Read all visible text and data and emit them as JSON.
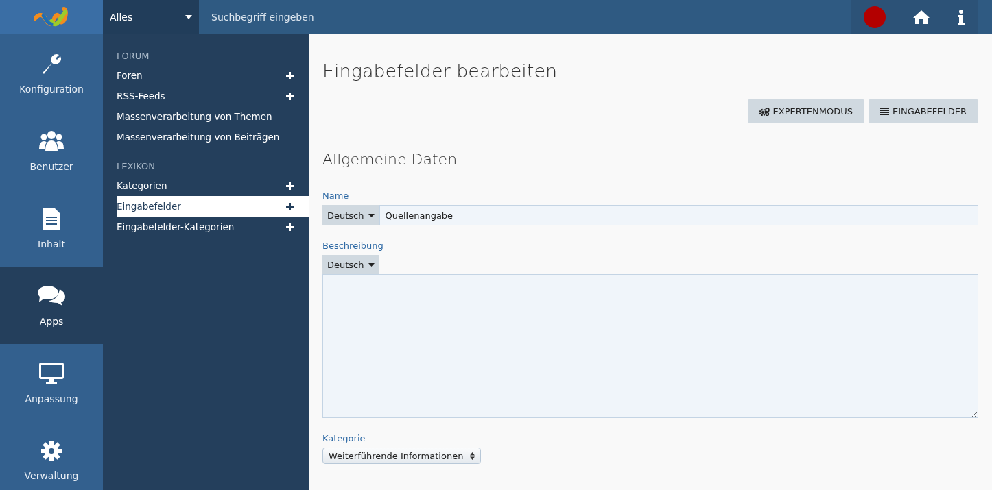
{
  "header": {
    "search_scope": "Alles",
    "search": {
      "placeholder": "Suchbegriff eingeben"
    }
  },
  "main_menu": [
    {
      "label": "Konfiguration",
      "selected": false
    },
    {
      "label": "Benutzer",
      "selected": false
    },
    {
      "label": "Inhalt",
      "selected": false
    },
    {
      "label": "Apps",
      "selected": true
    },
    {
      "label": "Anpassung",
      "selected": false
    },
    {
      "label": "Verwaltung",
      "selected": false
    }
  ],
  "sub_menu": [
    {
      "heading": "FORUM",
      "items": [
        {
          "label": "Foren",
          "selected": false,
          "add_button": true
        },
        {
          "label": "RSS-Feeds",
          "selected": false,
          "add_button": true
        },
        {
          "label": "Massenverarbeitung von Themen",
          "selected": false,
          "add_button": false
        },
        {
          "label": "Massenverarbeitung von Beiträgen",
          "selected": false,
          "add_button": false
        }
      ]
    },
    {
      "heading": "LEXIKON",
      "items": [
        {
          "label": "Kategorien",
          "selected": false,
          "add_button": true
        },
        {
          "label": "Eingabefelder",
          "selected": true,
          "add_button": true
        },
        {
          "label": "Eingabefelder-Kategorien",
          "selected": false,
          "add_button": true
        }
      ]
    }
  ],
  "page": {
    "title": "Eingabefelder bearbeiten",
    "actions": [
      {
        "label": "EXPERTENMODUS"
      },
      {
        "label": "EINGABEFELDER"
      }
    ],
    "section_title": "Allgemeine Daten",
    "name": {
      "label": "Name",
      "language": "Deutsch",
      "value": "Quellenangabe"
    },
    "description": {
      "label": "Beschreibung",
      "language": "Deutsch"
    },
    "category": {
      "label": "Kategorie",
      "value": "Weiterführende Informationen"
    }
  }
}
